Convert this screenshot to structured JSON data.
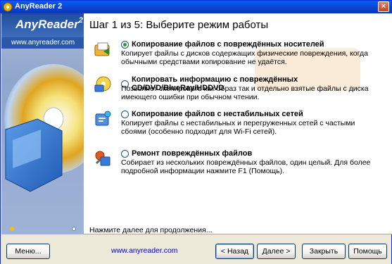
{
  "window": {
    "title": "AnyReader 2",
    "close_label": "×"
  },
  "sidebar": {
    "logo_name": "AnyReader",
    "logo_version": "2",
    "link_text": "www.anyreader.com"
  },
  "main": {
    "step_title": "Шаг 1 из 5: Выберите режим работы",
    "options": [
      {
        "label": "Копирование файлов с повреждённых носителей",
        "description": "Копирует файлы с дисков содержащих физические повреждения, когда обычными средствами копирование не удаётся.",
        "checked": true,
        "icon": "folder-copy-icon"
      },
      {
        "label": "Копировать информацию с повреждённых CD/DVD/BlueRay/HDDVD",
        "description": "Позволяет скопировать как образ так и отдельно взятые файлы с диска имеющего ошибки при обычном чтении.",
        "checked": false,
        "icon": "disc-copy-icon"
      },
      {
        "label": "Копирование файлов с нестабильных сетей",
        "description": "Копирует файлы с нестабильных и перегруженных сетей с частыми сбоями (особенно подходит для Wi-Fi сетей).",
        "checked": false,
        "icon": "network-copy-icon"
      },
      {
        "label": "Ремонт повреждённых файлов",
        "description": "Собирает из нескольких повреждённых файлов, один целый. Для более подробной информации нажмите F1 (Помощь).",
        "checked": false,
        "icon": "file-repair-icon"
      }
    ],
    "hint": "Нажмите далее для продолжения..."
  },
  "footer": {
    "menu_label": "Меню...",
    "site_link": "www.anyreader.com",
    "back_label": "< Назад",
    "next_label": "Далее >",
    "close_label": "Закрыть",
    "help_label": "Помощь"
  },
  "colors": {
    "titlebar": "#0B46D4",
    "link": "#0000CC",
    "radio_dot": "#21A121"
  }
}
